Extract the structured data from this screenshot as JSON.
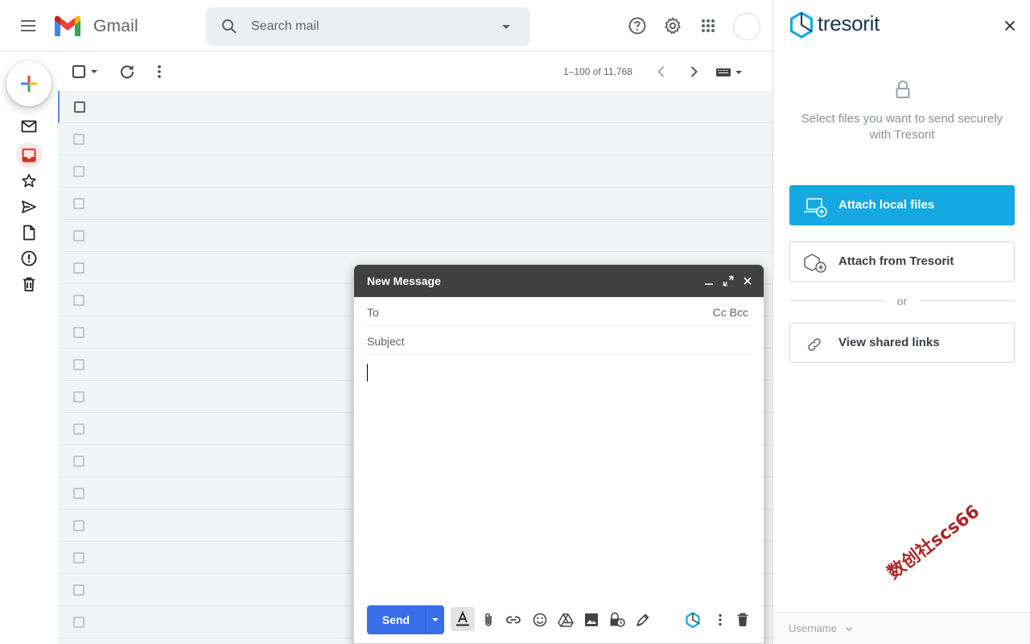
{
  "header": {
    "brand": "Gmail",
    "search": {
      "placeholder": "Search mail",
      "value": ""
    }
  },
  "toolbar": {
    "pager": "1–100 of 11,768"
  },
  "mail_list": {
    "row_count": 17
  },
  "compose": {
    "title": "New Message",
    "to_label": "To",
    "cc_bcc": "Cc Bcc",
    "subject_label": "Subject",
    "send_label": "Send"
  },
  "tresorit": {
    "brand": "tresorit",
    "message": "Select files you want to send securely with Tresorit",
    "attach_local": "Attach local files",
    "attach_tresorit": "Attach from Tresorit",
    "or": "or",
    "view_links": "View shared links",
    "username": "Username"
  },
  "watermark": "数创社scs66",
  "colors": {
    "send_blue": "#3a6ee8",
    "tresorit_blue": "#16a9e1",
    "compose_header": "#404040",
    "inbox_red": "#d93025"
  }
}
